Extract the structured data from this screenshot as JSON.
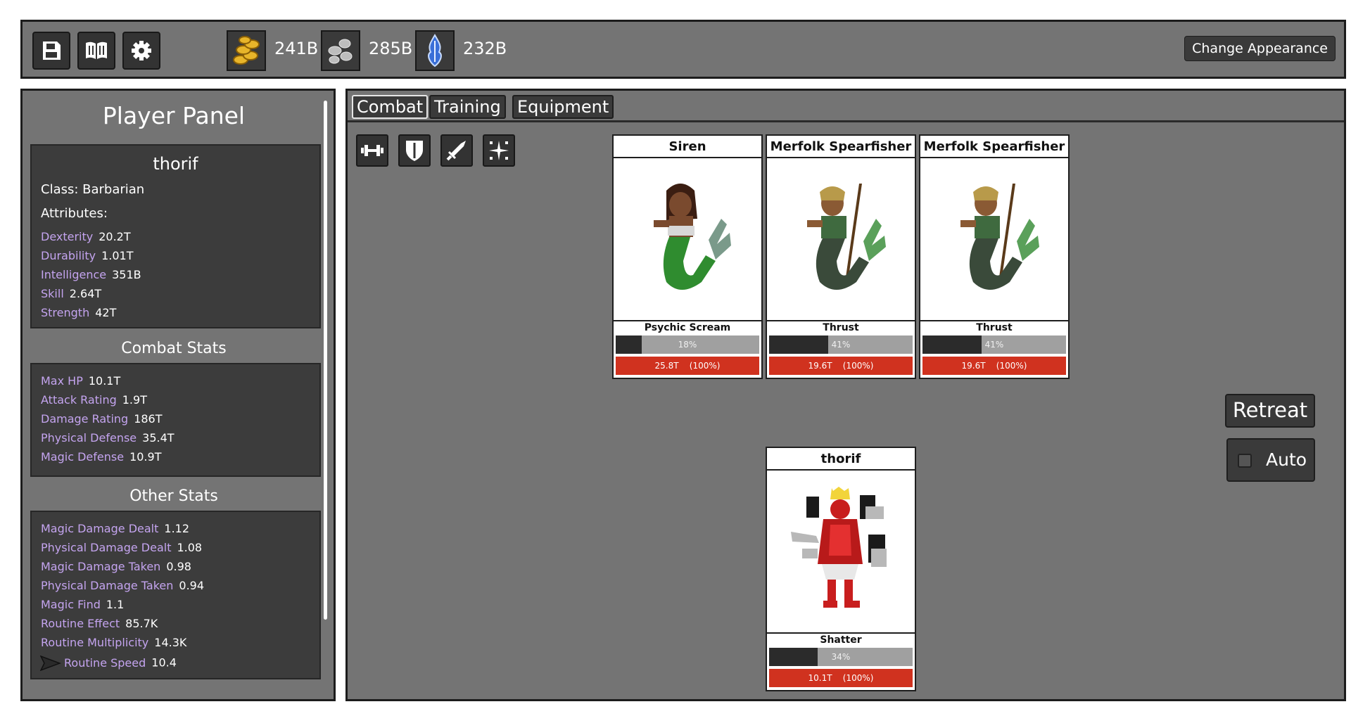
{
  "toolbar": {
    "buttons": [
      "save-icon",
      "book-icon",
      "gear-icon"
    ],
    "change_appearance_label": "Change Appearance"
  },
  "resources": [
    {
      "name": "gold-coins-icon",
      "value": "241B"
    },
    {
      "name": "stones-icon",
      "value": "285B"
    },
    {
      "name": "mana-icon",
      "value": "232B"
    }
  ],
  "player_panel": {
    "title": "Player Panel",
    "name": "thorif",
    "class_line": "Class: Barbarian",
    "attributes_label": "Attributes:",
    "attributes": [
      {
        "name": "Dexterity",
        "value": "20.2T"
      },
      {
        "name": "Durability",
        "value": "1.01T"
      },
      {
        "name": "Intelligence",
        "value": "351B"
      },
      {
        "name": "Skill",
        "value": "2.64T"
      },
      {
        "name": "Strength",
        "value": "42T"
      }
    ],
    "combat_title": "Combat Stats",
    "combat_stats": [
      {
        "name": "Max HP",
        "value": "10.1T"
      },
      {
        "name": "Attack Rating",
        "value": "1.9T"
      },
      {
        "name": "Damage Rating",
        "value": "186T"
      },
      {
        "name": "Physical Defense",
        "value": "35.4T"
      },
      {
        "name": "Magic Defense",
        "value": "10.9T"
      }
    ],
    "other_title": "Other Stats",
    "other_stats": [
      {
        "name": "Magic Damage Dealt",
        "value": "1.12"
      },
      {
        "name": "Physical Damage Dealt",
        "value": "1.08"
      },
      {
        "name": "Magic Damage Taken",
        "value": "0.98"
      },
      {
        "name": "Physical Damage Taken",
        "value": "0.94"
      },
      {
        "name": "Magic Find",
        "value": "1.1"
      },
      {
        "name": "Routine Effect",
        "value": "85.7K"
      },
      {
        "name": "Routine Multiplicity",
        "value": "14.3K"
      },
      {
        "name": "Routine Speed",
        "value": "10.4"
      }
    ]
  },
  "tabs": [
    "Combat",
    "Training",
    "Equipment"
  ],
  "skill_icons": [
    "dumbbell-icon",
    "shield-icon",
    "sword-icon",
    "sparkle-icon"
  ],
  "enemies": [
    {
      "name": "Siren",
      "skill": "Psychic Scream",
      "progress": 0.18,
      "progress_label": "18%",
      "hp": "25.8T    (100%)"
    },
    {
      "name": "Merfolk Spearfisher",
      "skill": "Thrust",
      "progress": 0.41,
      "progress_label": "41%",
      "hp": "19.6T    (100%)"
    },
    {
      "name": "Merfolk Spearfisher",
      "skill": "Thrust",
      "progress": 0.41,
      "progress_label": "41%",
      "hp": "19.6T    (100%)"
    }
  ],
  "player_card": {
    "name": "thorif",
    "skill": "Shatter",
    "progress": 0.34,
    "progress_label": "34%",
    "hp": "10.1T    (100%)"
  },
  "retreat_label": "Retreat",
  "auto_label": "Auto",
  "colors": {
    "panel": "#747474",
    "box": "#3c3c3c",
    "stat_name": "#c4a4ef",
    "hp_bar": "#d0321f"
  }
}
